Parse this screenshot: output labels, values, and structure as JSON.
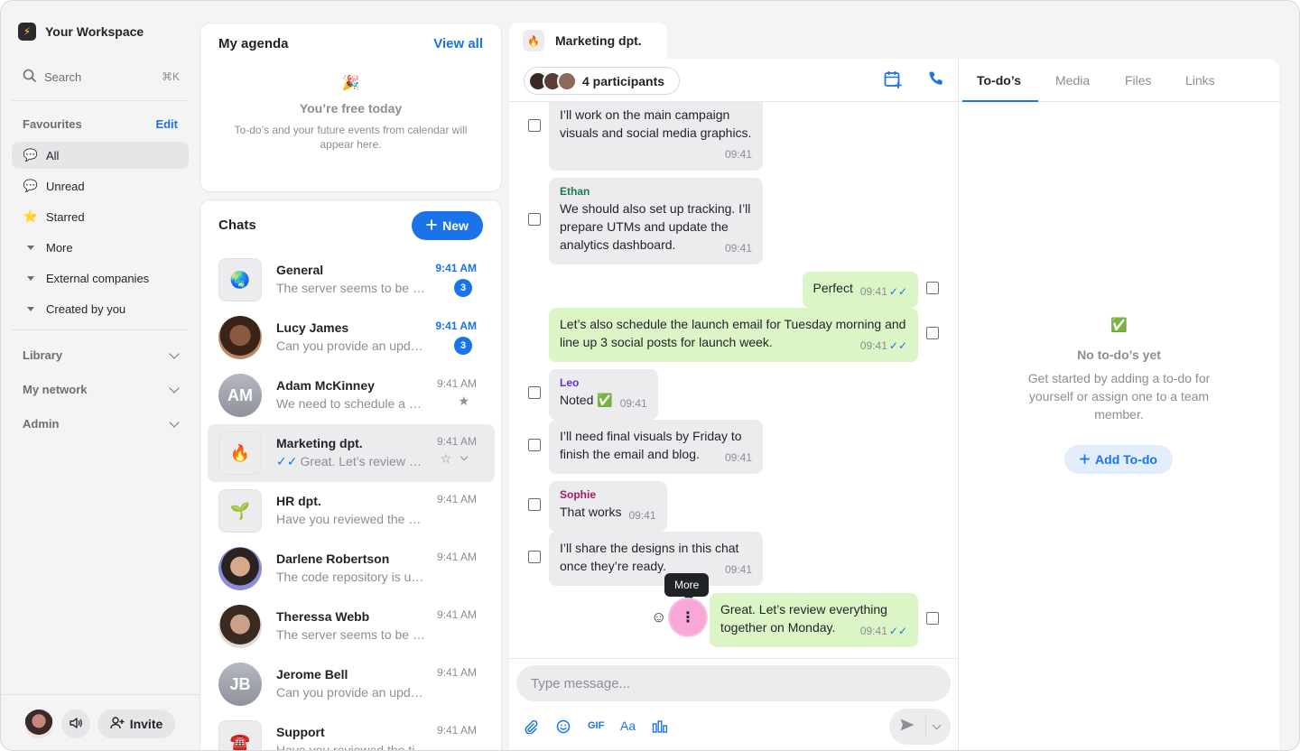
{
  "workspace": {
    "name": "Your Workspace",
    "logo_icon": "lightning-icon"
  },
  "search": {
    "label": "Search",
    "shortcut": "⌘K"
  },
  "favourites": {
    "title": "Favourites",
    "edit_label": "Edit",
    "items": [
      {
        "label": "All",
        "icon": "chat-bubble-icon",
        "active": true
      },
      {
        "label": "Unread",
        "icon": "unread-chat-icon"
      },
      {
        "label": "Starred",
        "icon": "star-icon"
      },
      {
        "label": "More",
        "icon": "caret-down-icon"
      },
      {
        "label": "External companies",
        "icon": "caret-down-icon"
      },
      {
        "label": "Created by you",
        "icon": "caret-down-icon"
      }
    ]
  },
  "sections": [
    {
      "label": "Library"
    },
    {
      "label": "My network"
    },
    {
      "label": "Admin"
    }
  ],
  "footer": {
    "invite_label": "Invite"
  },
  "agenda": {
    "title": "My agenda",
    "view_all": "View all",
    "empty_title": "You’re free today",
    "empty_text": "To-do’s and your future events from calendar will appear here."
  },
  "chats": {
    "title": "Chats",
    "new_label": "New",
    "items": [
      {
        "name": "General",
        "preview": "The server seems to be down again",
        "time": "9:41 AM",
        "unread": "3",
        "avatar": "🌏"
      },
      {
        "name": "Lucy James",
        "preview": "Can you provide an update on the report?",
        "time": "9:41 AM",
        "unread": "3"
      },
      {
        "name": "Adam McKinney",
        "preview": "We need to schedule a meeting",
        "time": "9:41 AM",
        "initials": "AM",
        "starred": true
      },
      {
        "name": "Marketing dpt.",
        "preview": "Great. Let’s review everything",
        "time": "9:41 AM",
        "avatar": "🔥",
        "active": true
      },
      {
        "name": "HR dpt.",
        "preview": "Have you reviewed the new policy?",
        "time": "9:41 AM",
        "avatar": "🌱"
      },
      {
        "name": "Darlene Robertson",
        "preview": "The code repository is updated",
        "time": "9:41 AM"
      },
      {
        "name": "Theressa Webb",
        "preview": "The server seems to be down",
        "time": "9:41 AM"
      },
      {
        "name": "Jerome Bell",
        "preview": "Can you provide an update?",
        "time": "9:41 AM",
        "initials": "JB"
      },
      {
        "name": "Support",
        "preview": "Have you reviewed the ticket?",
        "time": "9:41 AM",
        "avatar": "☎️"
      }
    ]
  },
  "conversation": {
    "tab_title": "Marketing dpt.",
    "tab_icon": "🔥",
    "participants": "4 participants",
    "messages": [
      {
        "dir": "in",
        "text": "I’ll work on the main campaign visuals and social media graphics.",
        "time": "09:41"
      },
      {
        "dir": "in",
        "sender": "Ethan",
        "text": "We should also set up tracking. I’ll prepare UTMs and update the analytics dashboard.",
        "time": "09:41"
      },
      {
        "dir": "out",
        "text": "Perfect",
        "time": "09:41"
      },
      {
        "dir": "out",
        "text": "Let’s also schedule the launch email for Tuesday morning and line up 3 social posts for launch week.",
        "time": "09:41"
      },
      {
        "dir": "in",
        "sender": "Leo",
        "text": "Noted ✅",
        "time": "09:41"
      },
      {
        "dir": "in",
        "text": "I’ll need final visuals by Friday to finish the email and blog.",
        "time": "09:41"
      },
      {
        "dir": "in",
        "sender": "Sophie",
        "text": "That works",
        "time": "09:41"
      },
      {
        "dir": "in",
        "text": "I’ll share the designs in this chat once they’re ready.",
        "time": "09:41"
      },
      {
        "dir": "out",
        "text": "Great. Let’s review everything together on Monday.",
        "time": "09:41"
      }
    ],
    "tooltip": "More",
    "composer_placeholder": "Type message...",
    "tools": {
      "gif": "GIF",
      "format": "Aa"
    }
  },
  "right_panel": {
    "tabs": [
      "To-do’s",
      "Media",
      "Files",
      "Links"
    ],
    "empty_title": "No to-do’s yet",
    "empty_text": "Get started by adding a to-do for yourself or assign one to a team member.",
    "add_label": "Add To-do"
  },
  "colors": {
    "accent": "#1a73e8",
    "incoming_bubble": "#ececef",
    "outgoing_bubble": "#dcf5c6",
    "highlight": "#f8a8d8"
  }
}
